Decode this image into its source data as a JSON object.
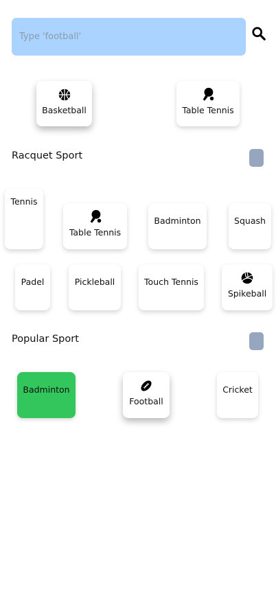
{
  "search": {
    "placeholder": "Type 'football'",
    "value": "",
    "icon": "search-icon"
  },
  "favorites": [
    {
      "label": "Basketball",
      "icon": "basketball-icon"
    },
    {
      "label": "Table Tennis",
      "icon": "ping-pong-icon"
    }
  ],
  "racquet": {
    "title": "Racquet Sport",
    "items": [
      {
        "label": "Tennis"
      },
      {
        "label": "Table Tennis",
        "icon": "ping-pong-icon"
      },
      {
        "label": "Badminton"
      },
      {
        "label": "Squash"
      },
      {
        "label": "Padel"
      },
      {
        "label": "Pickleball"
      },
      {
        "label": "Touch Tennis"
      },
      {
        "label": "Spikeball",
        "icon": "volleyball-icon"
      }
    ]
  },
  "popular": {
    "title": "Popular Sport",
    "items": [
      {
        "label": "Badminton",
        "selected": true
      },
      {
        "label": "Football",
        "icon": "football-icon"
      },
      {
        "label": "Cricket"
      }
    ]
  },
  "colors": {
    "search_bg": "#aad4ff",
    "selected_bg": "#33c65c",
    "toggle": "#97a6bf"
  }
}
